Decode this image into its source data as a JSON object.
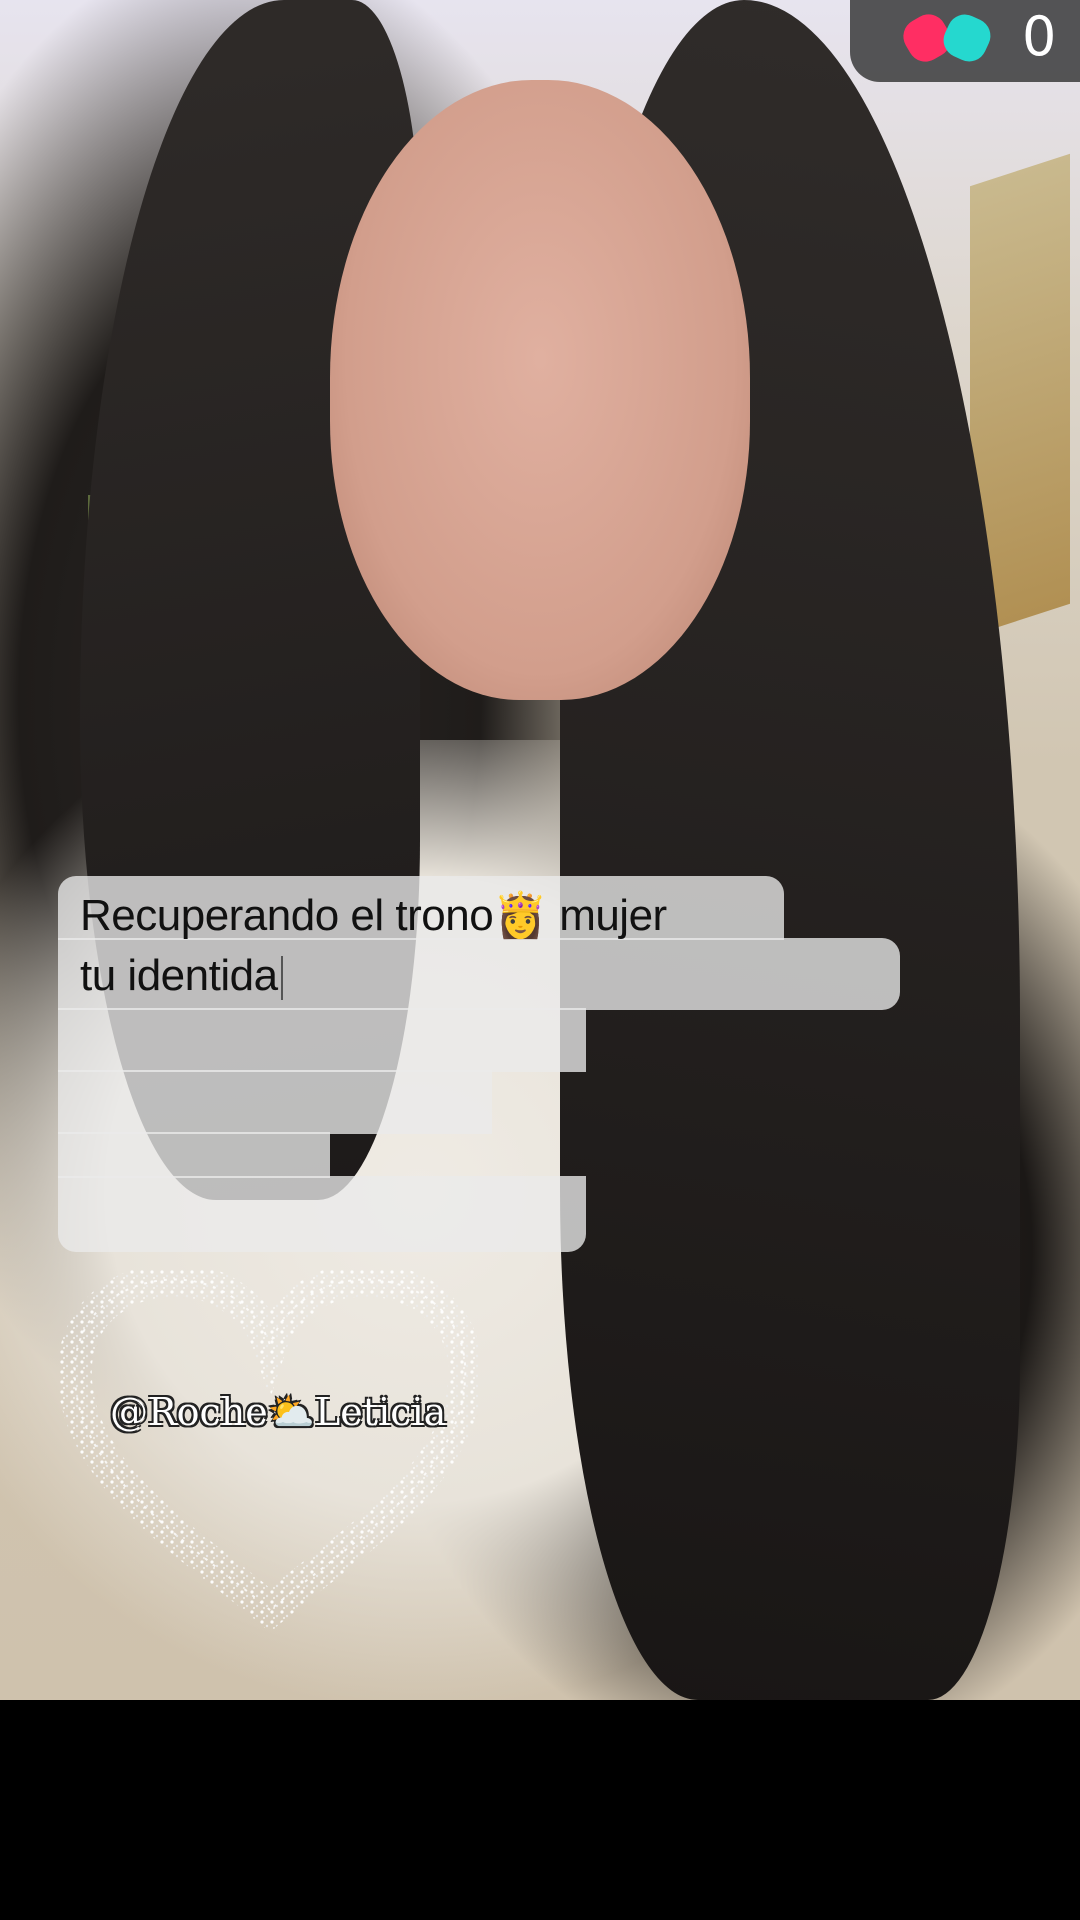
{
  "live_badge": {
    "icon": "boxing-gloves-icon",
    "count": "0",
    "colors": {
      "glove_left": "#ff2e63",
      "glove_right": "#25d8cf"
    }
  },
  "caption": {
    "line1": "Recuperando el trono👸 mujer",
    "line2": "tu identida"
  },
  "sticker": {
    "handle": "@Roche⛅Leticia",
    "shape": "sparkle-heart"
  }
}
